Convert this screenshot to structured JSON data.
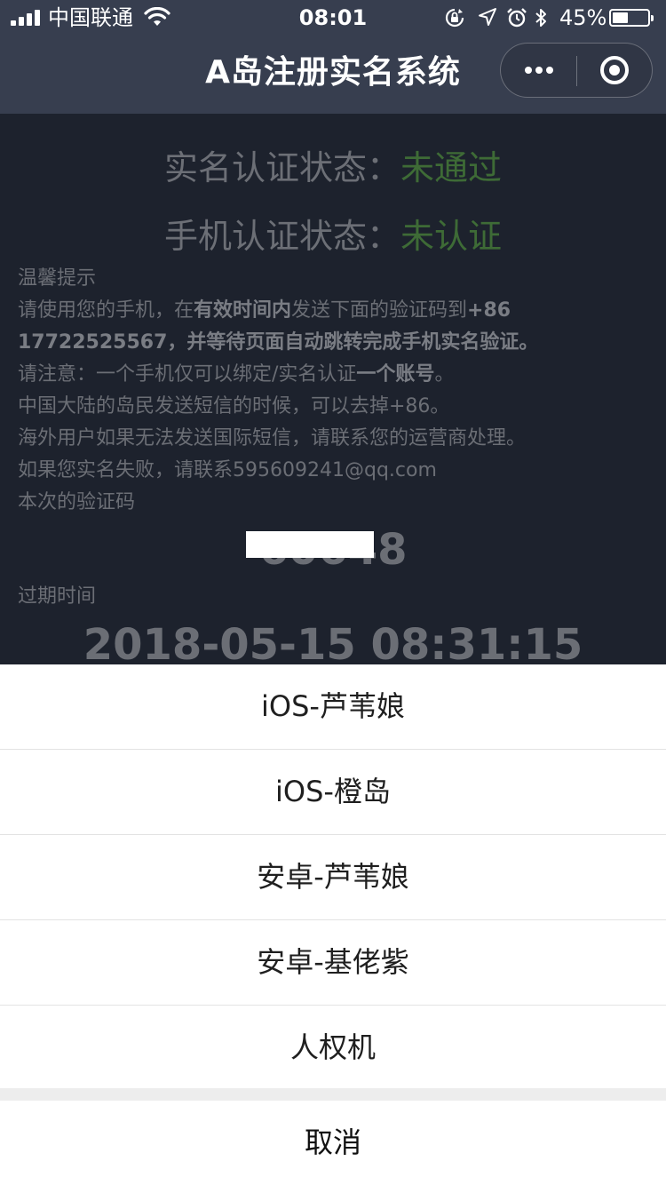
{
  "status_bar": {
    "carrier": "中国联通",
    "time": "08:01",
    "battery_pct": "45%",
    "battery_level": 0.45,
    "icons": [
      "signal-icon",
      "wifi-icon",
      "orientation-lock-icon",
      "location-icon",
      "alarm-icon",
      "bluetooth-icon",
      "battery-icon"
    ]
  },
  "nav": {
    "title": "A岛注册实名系统",
    "more_icon": "more-dots-icon",
    "close_icon": "close-circle-icon"
  },
  "verification": {
    "realname_label": "实名认证状态：",
    "realname_value": "未通过",
    "phone_label": "手机认证状态：",
    "phone_value": "未认证",
    "value_color": "#3e6b36"
  },
  "tips": {
    "heading": "温馨提示",
    "l1_a": "请使用您的手机，在",
    "l1_b": "有效时间内",
    "l1_c": "发送下面的验证码到",
    "l1_d": "+86 17722525567，并等待页面自动跳转完成手机实名验证。",
    "l2_a": "请注意：一个手机仅可以绑定/实名认证",
    "l2_b": "一个账号",
    "l2_c": "。",
    "l3": "中国大陆的岛民发送短信的时候，可以去掉+86。",
    "l4": "海外用户如果无法发送国际短信，请联系您的运营商处理。",
    "l5": "如果您实名失败，请联系595609241@qq.com",
    "l6": "本次的验证码"
  },
  "code": {
    "visible_text": "60648"
  },
  "expire": {
    "label": "过期时间",
    "value": "2018-05-15 08:31:15"
  },
  "sheet": {
    "items": [
      "iOS-芦苇娘",
      "iOS-橙岛",
      "安卓-芦苇娘",
      "安卓-基佬紫",
      "人权机"
    ],
    "cancel": "取消"
  }
}
